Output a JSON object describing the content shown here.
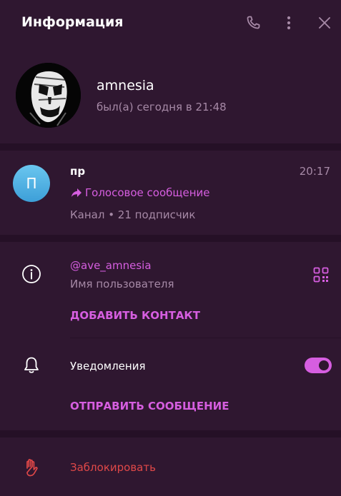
{
  "header": {
    "title": "Информация",
    "icons": [
      "phone-icon",
      "more-vertical-icon",
      "close-icon"
    ]
  },
  "profile": {
    "name": "amnesia",
    "status": "был(а) сегодня в 21:48"
  },
  "channel": {
    "avatar_letter": "П",
    "name": "пр",
    "time": "20:17",
    "message": "Голосовое сообщение",
    "meta": "Канал • 21 подписчик"
  },
  "info": {
    "username": "@ave_amnesia",
    "username_label": "Имя пользователя",
    "add_contact": "ДОБАВИТЬ КОНТАКТ",
    "notifications_label": "Уведомления",
    "notifications_enabled": true,
    "send_message": "ОТПРАВИТЬ СООБЩЕНИЕ"
  },
  "block": {
    "label": "Заблокировать"
  },
  "colors": {
    "background": "#2f1730",
    "divider": "#251026",
    "accent": "#d65ee0",
    "secondary_text": "#a689a6",
    "danger": "#e04848"
  }
}
